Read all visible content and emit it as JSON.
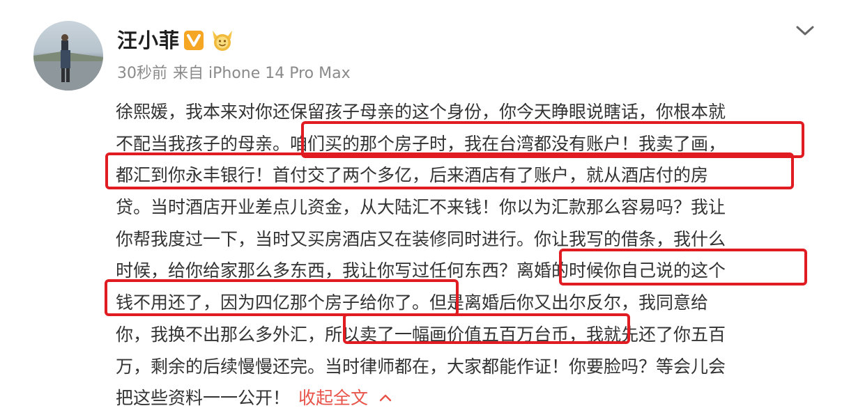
{
  "post": {
    "author": "汪小菲",
    "time": "30秒前",
    "source": "来自 iPhone 14 Pro Max",
    "collapse_label": "收起全文",
    "lines": [
      "徐熙媛，我本来对你还保留孩子母亲的这个身份，你今天睁眼说瞎话，你根本就",
      "不配当我孩子的母亲。咱们买的那个房子时，我在台湾都没有账户！我卖了画，",
      "都汇到你永丰银行！首付交了两个多亿，后来酒店有了账户，就从酒店付的房",
      "贷。当时酒店开业差点儿资金，从大陆汇不来钱！你以为汇款那么容易吗？我让",
      "你帮我度过一下，当时又买房酒店又在装修同时进行。你让我写的借条，我什么",
      "时候，给你给家那么多东西，我让你写过任何东西？离婚的时候你自己说的这个",
      "钱不用还了，因为四亿那个房子给你了。但是离婚后你又出尔反尔，我同意给",
      "你，我换不出那么多外汇，所以卖了一幅画价值五百万台币，我就先还了你五百",
      "万，剩余的后续慢慢还完。当时律师都在，大家都能作证！你要脸吗？等会儿会",
      "把这些资料一一公开！"
    ]
  },
  "icons": {
    "verified": "verified-v-badge-icon",
    "medal": "fan-medal-icon",
    "more": "chevron-down-icon",
    "collapse": "chevron-up-icon"
  },
  "colors": {
    "highlight": "#e11b22",
    "collapse_link": "#e8534a",
    "verified_badge": "#f5a623"
  }
}
